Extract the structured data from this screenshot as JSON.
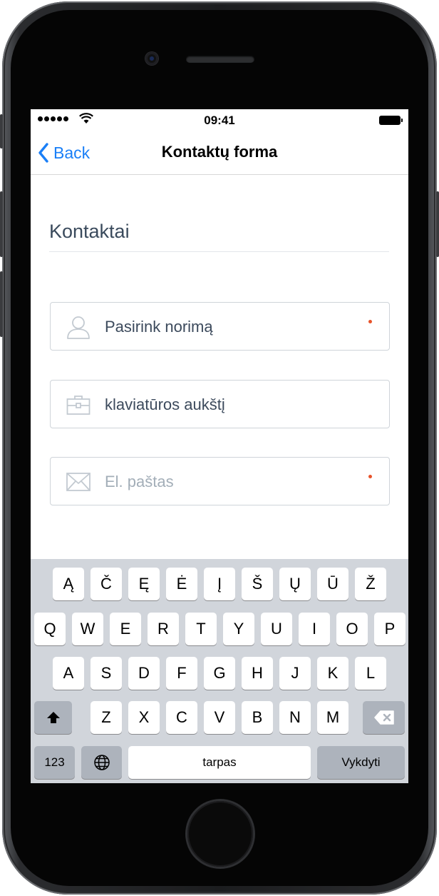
{
  "status_bar": {
    "time": "09:41",
    "signal_icon": "cellular-signal-icon",
    "wifi_icon": "wifi-icon",
    "battery_icon": "battery-icon",
    "battery_level": 1.0
  },
  "nav": {
    "back_label": "Back",
    "title": "Kontaktų forma",
    "accent_color": "#1a7ff7"
  },
  "form": {
    "section_title": "Kontaktai",
    "fields": [
      {
        "icon": "person-icon",
        "value": "Pasirink norimą",
        "placeholder": "",
        "required": true
      },
      {
        "icon": "briefcase-icon",
        "value": "klaviatūros aukštį",
        "placeholder": "",
        "required": false
      },
      {
        "icon": "envelope-icon",
        "value": "",
        "placeholder": "El. paštas",
        "required": true
      }
    ],
    "required_color": "#e8532a"
  },
  "keyboard": {
    "row0": [
      "Ą",
      "Č",
      "Ę",
      "Ė",
      "Į",
      "Š",
      "Ų",
      "Ū",
      "Ž"
    ],
    "row1": [
      "Q",
      "W",
      "E",
      "R",
      "T",
      "Y",
      "U",
      "I",
      "O",
      "P"
    ],
    "row2": [
      "A",
      "S",
      "D",
      "F",
      "G",
      "H",
      "J",
      "K",
      "L"
    ],
    "row3": [
      "Z",
      "X",
      "C",
      "V",
      "B",
      "N",
      "M"
    ],
    "shift_icon": "shift-icon",
    "delete_icon": "backspace-icon",
    "globe_icon": "globe-icon",
    "numbers_label": "123",
    "space_label": "tarpas",
    "return_label": "Vykdyti"
  }
}
